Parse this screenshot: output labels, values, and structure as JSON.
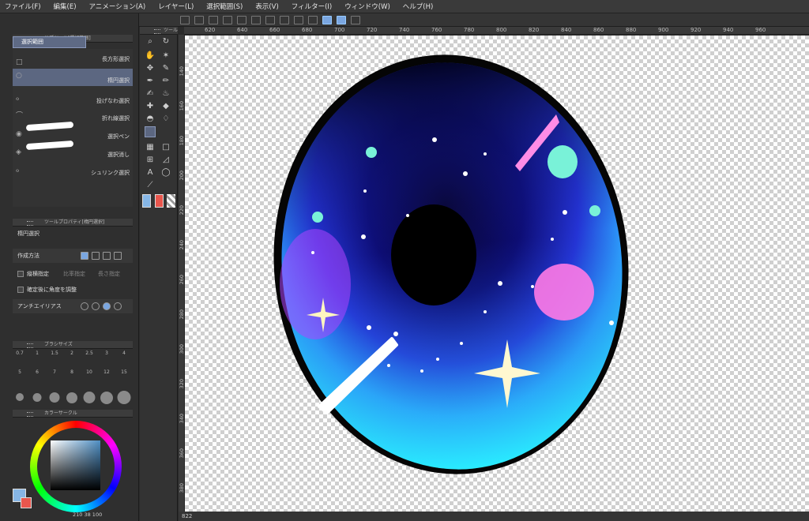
{
  "menu": [
    "ファイル(F)",
    "編集(E)",
    "アニメーション(A)",
    "レイヤー(L)",
    "選択範囲(S)",
    "表示(V)",
    "フィルター(I)",
    "ウィンドウ(W)",
    "ヘルプ(H)"
  ],
  "subtool": {
    "header": "サブツール[選択範囲]",
    "tab": "選択範囲",
    "items": [
      "長方形選択",
      "楕円選択",
      "投げなわ選択",
      "折れ線選択",
      "選択ペン",
      "選択消し",
      "シュリンク選択"
    ]
  },
  "toolprop": {
    "header": "ツールプロパティ[楕円選択]",
    "name": "楕円選択",
    "create_method": "作成方法",
    "aspect": "縦横指定",
    "ratio": "比率指定",
    "length": "長さ指定",
    "adjust": "確定後に角度を調整",
    "antialias": "アンチエイリアス"
  },
  "brush": {
    "header": "ブラシサイズ",
    "sizes": [
      "0.7",
      "1",
      "1.5",
      "2",
      "2.5",
      "3",
      "4",
      "5",
      "6",
      "7",
      "8",
      "10",
      "12",
      "15"
    ]
  },
  "color": {
    "header": "カラーサークル",
    "main": "#86b6e6",
    "sub": "#e9564d",
    "readout": "210  38  100"
  },
  "toolpanel": {
    "header": "ツール"
  },
  "ruler_top": [
    "620",
    "640",
    "660",
    "680",
    "700",
    "720",
    "740",
    "760",
    "780",
    "800",
    "820",
    "840",
    "860",
    "880",
    "900",
    "920",
    "940",
    "960"
  ],
  "ruler_left": [
    "140",
    "160",
    "180",
    "200",
    "220",
    "240",
    "260",
    "280",
    "300",
    "320",
    "340",
    "360",
    "380"
  ],
  "status": {
    "zoom": "822"
  }
}
